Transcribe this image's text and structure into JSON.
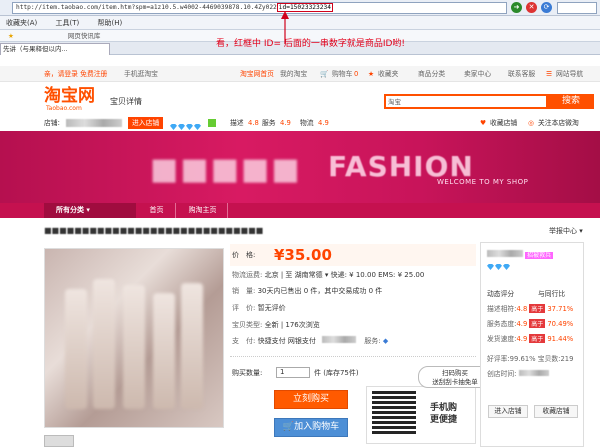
{
  "browser": {
    "url_prefix": "http://item.taobao.com/item.htm?spm=a1z10.5.w4002-4469039878.10.4Zy022",
    "url_id": "id=15023323234",
    "menu": [
      "收藏夹",
      "工具",
      "帮助"
    ],
    "menu_keys": [
      "(A)",
      "(T)",
      "(H)"
    ],
    "fav_text": "网页快讯库",
    "tab_title": "先讲（与果释但以内..."
  },
  "annotation": "看，红框中 ID= 后面的一串数字就是商品ID哟!",
  "taobao": {
    "top_left": "亲，请登录 免费注册",
    "mobile": "手机逛淘宝",
    "home": "淘宝网首页",
    "my_taobao": "我的淘宝",
    "cart": "购物车",
    "cart_count": "0",
    "favorites": "收藏夹",
    "category": "商品分类",
    "seller": "卖家中心",
    "service": "联系客服",
    "sitemap": "网站导航",
    "logo": "淘宝网",
    "logo_sub": "Taobao.com",
    "detail": "宝贝详情",
    "search_scope": "淘宝",
    "search_btn": "搜索"
  },
  "shop": {
    "label": "店铺:",
    "enter": "进入店铺",
    "desc_label": "描述",
    "desc_score": "4.8",
    "service_label": "服务",
    "service_score": "4.9",
    "ship_label": "物流",
    "ship_score": "4.9",
    "collect": "收藏店铺",
    "follow": "关注本店微淘",
    "banner_fashion": "FASHION",
    "banner_welcome": "WELCOME TO MY SHOP",
    "nav": [
      "所有分类",
      "首页",
      "购淘主页"
    ]
  },
  "product": {
    "share": "举报中心",
    "price_label": "价　格:",
    "price": "¥35.00",
    "freight_label": "物流运费:",
    "freight": "北京 | 至 湖南常德 ▾  快递: ¥ 10.00  EMS: ¥ 25.00",
    "sales_label": "销　量:",
    "sales": "30天内已售出 0 件，其中交易成功 0 件",
    "review_label": "评　价:",
    "review": "暂无评价",
    "type_label": "宝贝类型:",
    "type": "全新 | 176次浏览",
    "pay_label": "支　付:",
    "pay": "快捷支付  网银支付",
    "service_label": "服务:",
    "qty_label": "购买数量:",
    "qty": "1",
    "stock": "件 (库存75件)",
    "buy": "立刻购买",
    "cart": "加入购物车",
    "qr_title1": "手机购",
    "qr_title2": "更便捷",
    "scan1": "扫码购买",
    "scan2": "送刮刮卡抽免单"
  },
  "rpanel": {
    "badge": "招被救兵",
    "dyn_label": "动态评分",
    "peer_label": "与同行比",
    "rows": [
      {
        "label": "描述相符:",
        "score": "4.8",
        "tag": "高于",
        "pct": "37.71%"
      },
      {
        "label": "服务态度:",
        "score": "4.9",
        "tag": "高于",
        "pct": "70.49%"
      },
      {
        "label": "发货速度:",
        "score": "4.9",
        "tag": "高于",
        "pct": "91.44%"
      }
    ],
    "good": "好评率:99.61%",
    "praise": "宝贝数:219",
    "time_label": "创店时间:",
    "enter": "进入店铺",
    "collect": "收藏店铺"
  }
}
